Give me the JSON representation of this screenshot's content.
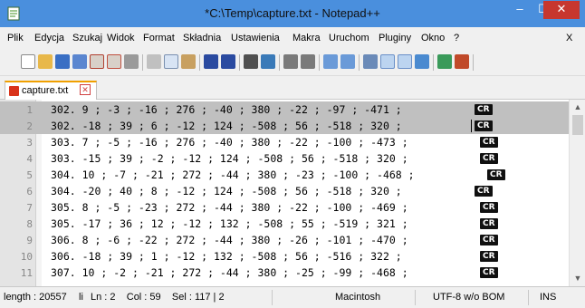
{
  "window": {
    "title": "*C:\\Temp\\capture.txt - Notepad++",
    "controls": {
      "minimize": "–",
      "maximize": "☐",
      "close": "✕"
    }
  },
  "menu": {
    "items": [
      "Plik",
      "Edycja",
      "Szukaj",
      "Widok",
      "Format",
      "Składnia",
      "Ustawienia",
      "Makra",
      "Uruchom",
      "Pluginy",
      "Okno",
      "?"
    ],
    "close": "X"
  },
  "toolbar": {
    "icons": [
      "new-file-icon",
      "open-file-icon",
      "save-icon",
      "save-all-icon",
      "close-icon",
      "close-all-icon",
      "print-icon",
      "cut-icon",
      "copy-icon",
      "paste-icon",
      "undo-icon",
      "redo-icon",
      "find-icon",
      "replace-icon",
      "zoom-in-icon",
      "zoom-out-icon",
      "sync-v-icon",
      "sync-h-icon",
      "word-wrap-icon",
      "show-all-chars-icon",
      "indent-guide-icon",
      "user-lang-icon",
      "doc-map-icon",
      "function-list-icon"
    ]
  },
  "tab": {
    "label": "capture.txt",
    "close": "✕"
  },
  "editor": {
    "eol_marker": "CR",
    "lines": [
      {
        "num": "1",
        "text": "302. 9 ; -3 ; -16 ; 276 ; -40 ; 380 ; -22 ; -97 ; -471 ;"
      },
      {
        "num": "2",
        "text": "302. -18 ; 39 ; 6 ; -12 ; 124 ; -508 ; 56 ; -518 ; 320 ;"
      },
      {
        "num": "3",
        "text": "303. 7 ; -5 ; -16 ; 276 ; -40 ; 380 ; -22 ; -100 ; -473 ;"
      },
      {
        "num": "4",
        "text": "303. -15 ; 39 ; -2 ; -12 ; 124 ; -508 ; 56 ; -518 ; 320 ;"
      },
      {
        "num": "5",
        "text": "304. 10 ; -7 ; -21 ; 272 ; -44 ; 380 ; -23 ; -100 ; -468 ;"
      },
      {
        "num": "6",
        "text": "304. -20 ; 40 ; 8 ; -12 ; 124 ; -508 ; 56 ; -518 ; 320 ;"
      },
      {
        "num": "7",
        "text": "305. 8 ; -5 ; -23 ; 272 ; -44 ; 380 ; -22 ; -100 ; -469 ;"
      },
      {
        "num": "8",
        "text": "305. -17 ; 36 ; 12 ; -12 ; 132 ; -508 ; 55 ; -519 ; 321 ;"
      },
      {
        "num": "9",
        "text": "306. 8 ; -6 ; -22 ; 272 ; -44 ; 380 ; -26 ; -101 ; -470 ;"
      },
      {
        "num": "10",
        "text": "306. -18 ; 39 ; 1 ; -12 ; 132 ; -508 ; 56 ; -516 ; 322 ;"
      },
      {
        "num": "11",
        "text": "307. 10 ; -2 ; -21 ; 272 ; -44 ; 380 ; -25 ; -99 ; -468 ;"
      }
    ]
  },
  "status": {
    "length": "length : 20557",
    "lines": "li",
    "position": "Ln : 2    Col : 59    Sel : 117 | 2",
    "eol": "Macintosh",
    "encoding": "UTF-8 w/o BOM",
    "mode": "INS"
  },
  "colors": {
    "titlebar": "#4a8fdd",
    "close_button": "#c7372f",
    "selection": "#c0c0c0",
    "tab_accent": "#f0a000"
  }
}
